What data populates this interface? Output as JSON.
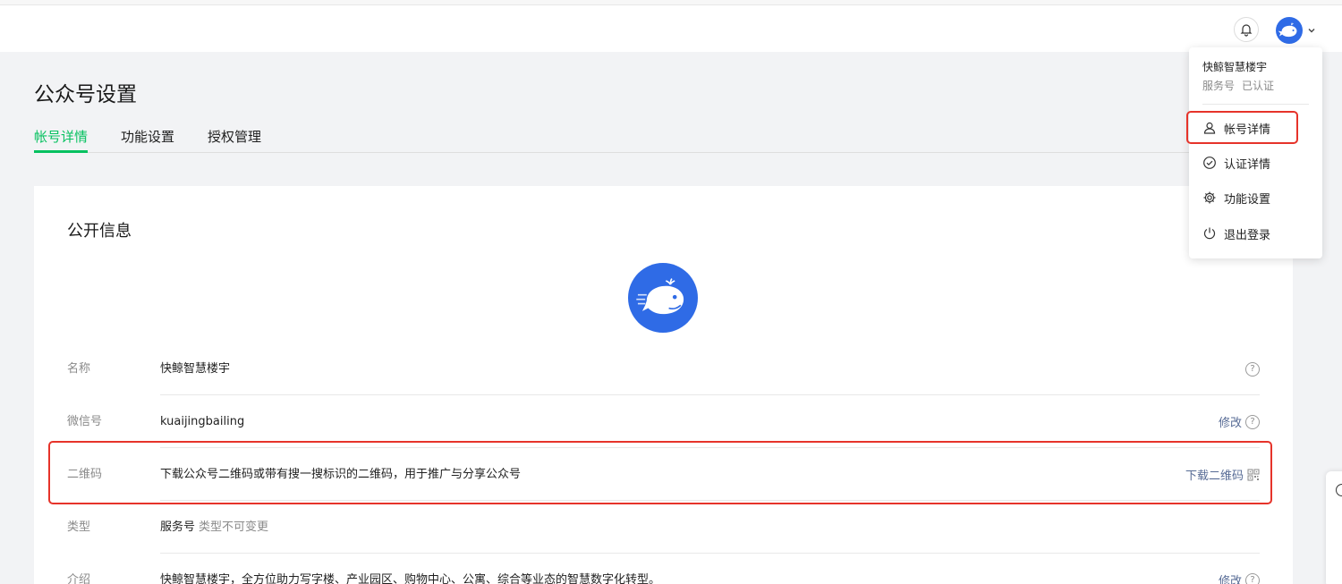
{
  "header": {
    "bell_icon": "bell-icon",
    "avatar_icon": "whale-logo-icon",
    "chevron_icon": "chevron-down-icon"
  },
  "page": {
    "title": "公众号设置",
    "tabs": [
      {
        "label": "帐号详情",
        "active": true
      },
      {
        "label": "功能设置",
        "active": false
      },
      {
        "label": "授权管理",
        "active": false
      }
    ]
  },
  "public_info": {
    "title": "公开信息",
    "rows": [
      {
        "label": "名称",
        "value": "快鲸智慧楼宇",
        "value_note": "",
        "action": ""
      },
      {
        "label": "微信号",
        "value": "kuaijingbailing",
        "value_note": "",
        "action": "修改"
      },
      {
        "label": "二维码",
        "value": "下载公众号二维码或带有搜一搜标识的二维码，用于推广与分享公众号",
        "value_note": "",
        "action": "下载二维码"
      },
      {
        "label": "类型",
        "value": "服务号",
        "value_note": "类型不可变更",
        "action": ""
      },
      {
        "label": "介绍",
        "value": "快鲸智慧楼宇，全方位助力写字楼、产业园区、购物中心、公寓、综合等业态的智慧数字化转型。",
        "value_note": "",
        "action": "修改"
      }
    ],
    "help_glyph": "?"
  },
  "dropdown": {
    "account_name": "快鲸智慧楼宇",
    "account_type": "服务号",
    "verified": "已认证",
    "items": [
      {
        "label": "帐号详情",
        "icon": "user-icon"
      },
      {
        "label": "认证详情",
        "icon": "check-circle-icon"
      },
      {
        "label": "功能设置",
        "icon": "gear-icon"
      },
      {
        "label": "退出登录",
        "icon": "power-icon"
      }
    ]
  },
  "colors": {
    "accent_green": "#07c160",
    "link_blue": "#576b95",
    "highlight_red": "#e6332a",
    "brand_blue": "#2f6be6"
  }
}
